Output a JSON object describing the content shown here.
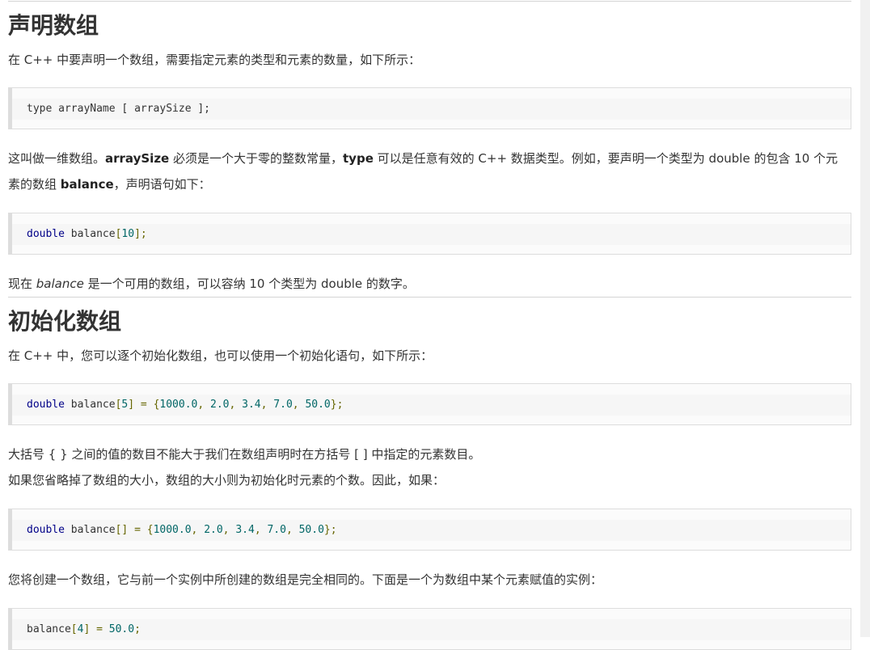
{
  "sections": {
    "declare": {
      "title": "声明数组",
      "intro": "在 C++ 中要声明一个数组，需要指定元素的类型和元素的数量，如下所示：",
      "code1": {
        "type": "type",
        "name": "arrayName",
        "lbracket": "[",
        "size": "arraySize",
        "rbracket": "];"
      },
      "p2": {
        "t1": "这叫做一维数组。",
        "b1": "arraySize",
        "t2": " 必须是一个大于零的整数常量，",
        "b2": "type",
        "t3": " 可以是任意有效的 C++ 数据类型。例如，要声明一个类型为 double 的包含 10 个元素的数组 ",
        "b3": "balance",
        "t4": "，声明语句如下："
      },
      "code2": {
        "type": "double",
        "name": "balance",
        "open": "[",
        "size": "10",
        "close": "];"
      },
      "p3": {
        "t1": "现在 ",
        "i1": "balance",
        "t2": " 是一个可用的数组，可以容纳 10 个类型为 double 的数字。"
      }
    },
    "init": {
      "title": "初始化数组",
      "intro": "在 C++ 中，您可以逐个初始化数组，也可以使用一个初始化语句，如下所示：",
      "code1": {
        "type": "double",
        "name": "balance",
        "open": "[",
        "size": "5",
        "close": "]",
        "assign": "=",
        "lbrace": "{",
        "values": [
          "1000.0",
          "2.0",
          "3.4",
          "7.0",
          "50.0"
        ],
        "end": "};"
      },
      "p2": "大括号 { } 之间的值的数目不能大于我们在数组声明时在方括号 [ ] 中指定的元素数目。",
      "p3": "如果您省略掉了数组的大小，数组的大小则为初始化时元素的个数。因此，如果：",
      "code2": {
        "type": "double",
        "name": "balance",
        "brackets": "[]",
        "assign": "=",
        "lbrace": "{",
        "values": [
          "1000.0",
          "2.0",
          "3.4",
          "7.0",
          "50.0"
        ],
        "end": "};"
      },
      "p4": "您将创建一个数组，它与前一个实例中所创建的数组是完全相同的。下面是一个为数组中某个元素赋值的实例：",
      "code3": {
        "name": "balance",
        "open": "[",
        "index": "4",
        "close": "]",
        "assign": "=",
        "value": "50.0",
        "end": ";"
      }
    }
  }
}
